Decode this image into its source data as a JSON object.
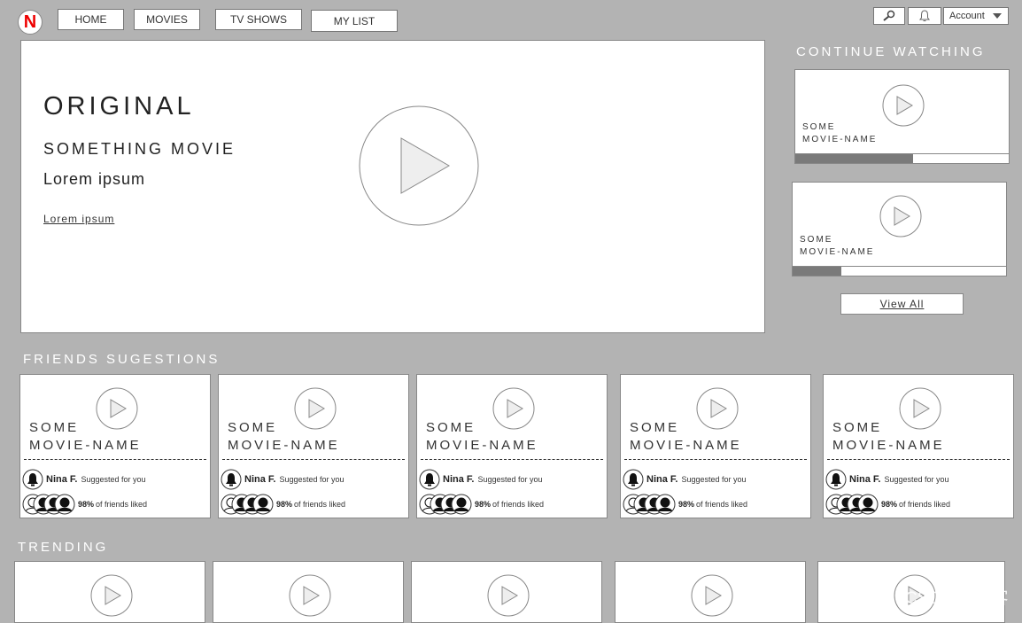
{
  "logo": {
    "letter": "N"
  },
  "nav": [
    "HOME",
    "MOVIES",
    "TV SHOWS",
    "MY LIST"
  ],
  "header": {
    "account_label": "Account",
    "search_icon": "search-icon",
    "bell_icon": "bell-icon"
  },
  "hero": {
    "title": "ORIGINAL",
    "subtitle": "SOMETHING MOVIE",
    "lorem": "Lorem ipsum",
    "link": "Lorem ipsum"
  },
  "continue_watching": {
    "title": "CONTINUE WATCHING",
    "items": [
      {
        "name_line1": "SOME",
        "name_line2": "MOVIE-NAME",
        "progress": 0.55
      },
      {
        "name_line1": "SOME",
        "name_line2": "MOVIE-NAME",
        "progress": 0.23
      }
    ],
    "view_all": "View All"
  },
  "friends": {
    "title": "FRIENDS SUGESTIONS",
    "items": [
      {
        "name_line1": "SOME",
        "name_line2": "MOVIE-NAME",
        "friend": "Nina F.",
        "suggested": "Suggested for you",
        "percent": "98%",
        "liked": "of friends liked"
      },
      {
        "name_line1": "SOME",
        "name_line2": "MOVIE-NAME",
        "friend": "Nina F.",
        "suggested": "Suggested for you",
        "percent": "98%",
        "liked": "of friends liked"
      },
      {
        "name_line1": "SOME",
        "name_line2": "MOVIE-NAME",
        "friend": "Nina F.",
        "suggested": "Suggested for you",
        "percent": "98%",
        "liked": "of friends liked"
      },
      {
        "name_line1": "SOME",
        "name_line2": "MOVIE-NAME",
        "friend": "Nina F.",
        "suggested": "Suggested for you",
        "percent": "98%",
        "liked": "of friends liked"
      },
      {
        "name_line1": "SOME",
        "name_line2": "MOVIE-NAME",
        "friend": "Nina F.",
        "suggested": "Suggested for you",
        "percent": "98%",
        "liked": "of friends liked"
      }
    ]
  },
  "trending": {
    "title": "TRENDING",
    "count": 5
  },
  "watermark": "CSDN @摹客"
}
